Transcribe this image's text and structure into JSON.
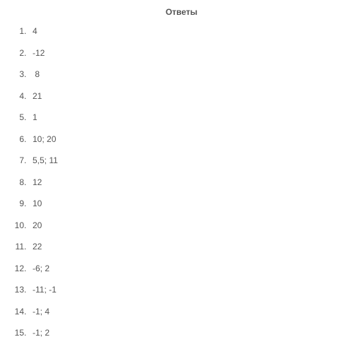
{
  "title": "Ответы",
  "answers": [
    {
      "n": "1",
      "v": "4"
    },
    {
      "n": "2",
      "v": "-12"
    },
    {
      "n": "3",
      "v": " 8"
    },
    {
      "n": "4",
      "v": "21"
    },
    {
      "n": "5",
      "v": "1"
    },
    {
      "n": "6",
      "v": "10; 20"
    },
    {
      "n": "7",
      "v": "5,5; 11"
    },
    {
      "n": "8",
      "v": "12"
    },
    {
      "n": "9",
      "v": "10"
    },
    {
      "n": "10",
      "v": "20"
    },
    {
      "n": "11",
      "v": "22"
    },
    {
      "n": "12",
      "v": "-6; 2"
    },
    {
      "n": "13",
      "v": "-11; -1"
    },
    {
      "n": "14",
      "v": "-1; 4"
    },
    {
      "n": "15",
      "v": "-1; 2"
    }
  ]
}
